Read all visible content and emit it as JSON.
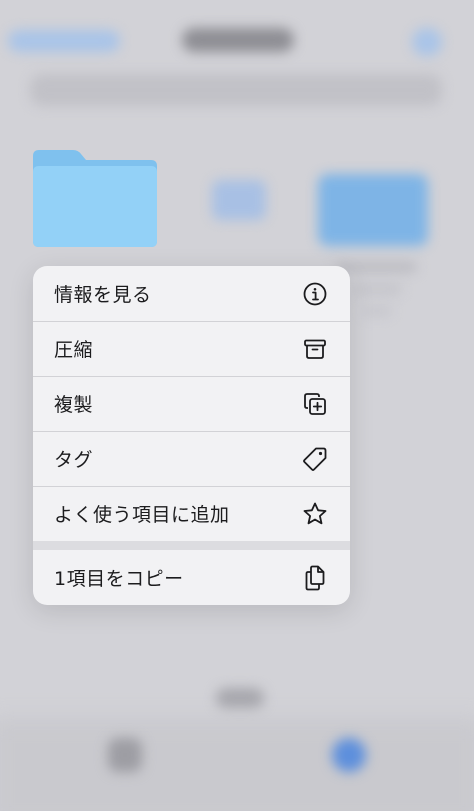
{
  "folder": {
    "color": "#8ecdf5",
    "color_dark": "#74b9ee"
  },
  "menu": {
    "items": [
      {
        "label": "情報を見る",
        "icon": "info-icon"
      },
      {
        "label": "圧縮",
        "icon": "archive-box-icon"
      },
      {
        "label": "複製",
        "icon": "duplicate-icon"
      },
      {
        "label": "タグ",
        "icon": "tag-icon"
      },
      {
        "label": "よく使う項目に追加",
        "icon": "star-icon"
      }
    ],
    "copy_item": {
      "label": "1項目をコピー",
      "icon": "copy-docs-icon"
    }
  },
  "colors": {
    "menu_background": "#f2f2f4",
    "text": "#1c1c1e",
    "separator": "#d2d2d6"
  }
}
